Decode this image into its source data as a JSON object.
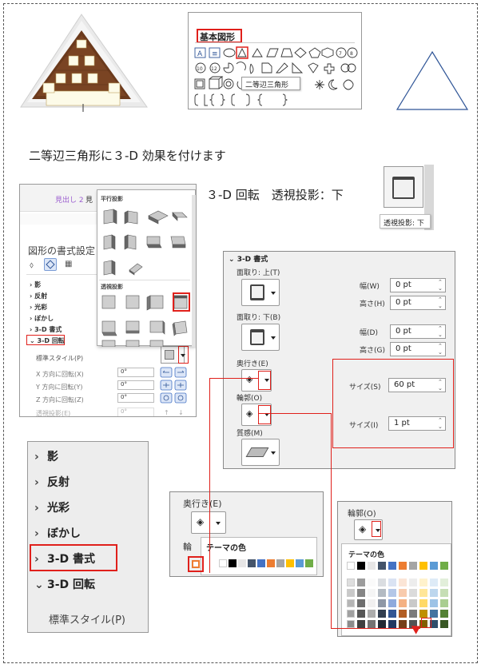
{
  "heading": "二等辺三角形に３-D 効果を付けます",
  "subheading": "３-D 回転　透視投影：下",
  "shapes_gallery": {
    "title": "基本図形",
    "tooltip": "二等辺三角形",
    "row_glyphs_3": [
      "⌣",
      "⌢",
      "{",
      "}",
      "⌈",
      "⌊",
      "{",
      "}"
    ]
  },
  "left_screenshot": {
    "ribbon_items": [
      "見出し 2",
      "見"
    ],
    "pane_title": "図形の書式設定",
    "sections": [
      "影",
      "反射",
      "光彩",
      "ぼかし",
      "3-D 書式",
      "3-D 回転"
    ],
    "std_style": "標準スタイル(P)",
    "x_rot": "X 方向に回転(X)",
    "y_rot": "Y 方向に回転(Y)",
    "z_rot": "Z 方向に回転(Z)",
    "persp": "透視投影(E)",
    "deg_x": "0°",
    "deg_y": "0°",
    "deg_z": "0°",
    "deg_p": "0°",
    "parallel": "平行投影",
    "perspective": "透視投影"
  },
  "thumb_tooltip": "透視投影: 下",
  "format3d": {
    "title": "3-D 書式",
    "bevel_top": "面取り: 上(T)",
    "bevel_bottom": "面取り: 下(B)",
    "width1_label": "幅(W)",
    "width1_val": "0 pt",
    "height1_label": "高さ(H)",
    "height1_val": "0 pt",
    "width2_label": "幅(D)",
    "width2_val": "0 pt",
    "height2_label": "高さ(G)",
    "height2_val": "0 pt",
    "depth": "奥行き(E)",
    "contour": "輪郭(O)",
    "material": "質感(M)",
    "size1_label": "サイズ(S)",
    "size1_val": "60 pt",
    "size2_label": "サイズ(I)",
    "size2_val": "1 pt"
  },
  "menu_zoom": {
    "items": [
      "影",
      "反射",
      "光彩",
      "ぼかし",
      "3-D 書式",
      "3-D 回転"
    ],
    "std_style": "標準スタイル(P)"
  },
  "depth_color": {
    "label": "奥行き(E)",
    "clipped_label": "輪",
    "theme": "テーマの色"
  },
  "contour_color": {
    "label": "輪郭(O)",
    "theme": "テーマの色"
  },
  "colors": {
    "accent_red": "#e0201b",
    "theme_row": [
      "#ffffff",
      "#000000",
      "#e7e6e6",
      "#44546a",
      "#4472c4",
      "#ed7d31",
      "#a5a5a5",
      "#ffc000",
      "#5b9bd5",
      "#70ad47"
    ]
  }
}
